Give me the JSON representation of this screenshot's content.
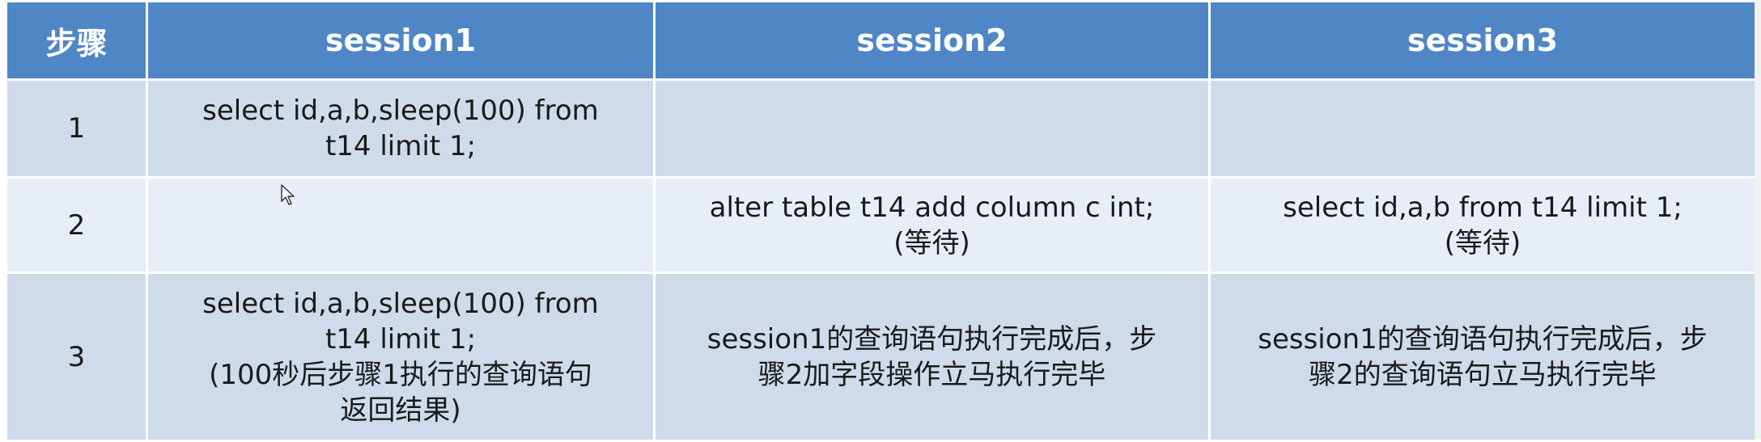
{
  "table": {
    "headers": [
      "步骤",
      "session1",
      "session2",
      "session3"
    ],
    "rows": [
      {
        "step": "1",
        "session1": [
          "select id,a,b,sleep(100) from",
          "t14 limit 1;"
        ],
        "session2": [],
        "session3": []
      },
      {
        "step": "2",
        "session1": [],
        "session2": [
          "alter table t14 add column c int;",
          "(等待)"
        ],
        "session3": [
          "select id,a,b from t14 limit 1;",
          "(等待)"
        ]
      },
      {
        "step": "3",
        "session1": [
          "select id,a,b,sleep(100) from",
          "t14 limit 1;",
          "(100秒后步骤1执行的查询语句",
          "返回结果)"
        ],
        "session2": [
          "session1的查询语句执行完成后，步",
          "骤2加字段操作立马执行完毕"
        ],
        "session3": [
          "session1的查询语句执行完成后，步",
          "骤2的查询语句立马执行完毕"
        ]
      }
    ]
  },
  "colors": {
    "header_bg": "#4f86c6",
    "row_odd_bg": "#cfdbeb",
    "row_even_bg": "#e8eef7"
  },
  "icons": {
    "mouse_cursor": "pointer-arrow"
  }
}
